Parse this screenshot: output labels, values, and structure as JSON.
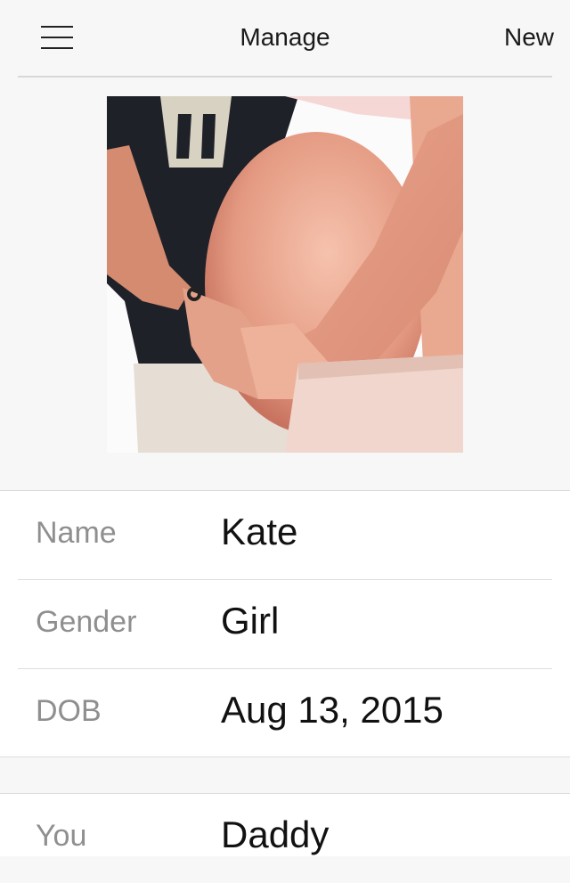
{
  "header": {
    "title": "Manage",
    "new_label": "New"
  },
  "photo": {
    "description_icon": "pregnancy-photo"
  },
  "details": {
    "name": {
      "label": "Name",
      "value": "Kate"
    },
    "gender": {
      "label": "Gender",
      "value": "Girl"
    },
    "dob": {
      "label": "DOB",
      "value": "Aug 13, 2015"
    }
  },
  "relation": {
    "label": "You",
    "value": "Daddy"
  },
  "colors": {
    "background": "#f7f7f7",
    "card": "#ffffff",
    "label": "#8f8f8f",
    "text": "#111111"
  }
}
